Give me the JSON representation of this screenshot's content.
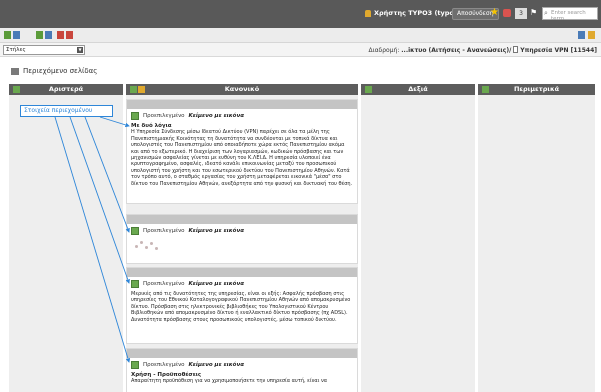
{
  "topbar": {
    "user_label": "Χρήστης TYPO3 (typo3user)",
    "logout_label": "Αποσύνδεση",
    "counter": "3",
    "search_placeholder": "Enter search term"
  },
  "selector": {
    "value": "Στήλες"
  },
  "breadcrumb": {
    "prefix": "Διαδρομή:",
    "path": "...iκτυο (Αιτήσεις - Ανανεώσεις)/",
    "page": "Υπηρεσία VPN [11544]"
  },
  "section_title": "Περιεχόμενο σελίδας",
  "columns": [
    {
      "label": "Αριστερά"
    },
    {
      "label": "Κανονικό"
    },
    {
      "label": "Δεξιά"
    },
    {
      "label": "Περιμετρικά"
    }
  ],
  "callout_label": "Στοιχεία περιεχομένου",
  "content_elements": [
    {
      "prefix": "Προεπιλεγμένο",
      "type": "Κείμενο με εικόνα",
      "heading": "Με δυό λόγια",
      "body": "Η Υπηρεσία Σύνδεσης μέσω Ιδεατού Δικτύου (VPN) παρέχει σε όλα τα μέλη της Πανεπιστημιακής Κοινότητας τη δυνατότητα να συνδέονται με τοπικά δίκτυα και υπολογιστές του Πανεπιστημίου από οποιαδήποτε χώρα εκτός Πανεπιστημίου ακόμα και από το εξωτερικό. Η διαχείριση των λογαριασμών, κωδικών πρόσβασης και των μηχανισμών ασφαλείας γίνεται με ευθύνη του Κ.ΛΕΙ.Δ. Η υπηρεσία υλοποιεί ένα κρυπτογραφημένο, ασφαλές, ιδεατό κανάλι επικοινωνίας μεταξύ του προσωπικού υπολογιστή του χρήστη και του εσωτερικού δικτύου του Πανεπιστημίου Αθηνών. Κατά τον τρόπο αυτό, ο σταθμός εργασίας του χρήστη μεταφέρεται εικονικά \"μέσα\" στο δίκτυο του Πανεπιστημίου Αθηνών, ανεξάρτητα από την φυσική και δικτυακή του θέση."
    },
    {
      "prefix": "Προεπιλεγμένο",
      "type": "Κείμενο με εικόνα"
    },
    {
      "prefix": "Προεπιλεγμένο",
      "type": "Κείμενο με εικόνα",
      "body": "Μερικές από τις δυνατότητες της υπηρεσίας, είναι οι εξής: Ασφαλής πρόσβαση στις υπηρεσίες του Εθνικού Καταλογογραφικού Πανεπιστημίου Αθηνών από απομακρυσμένο δίκτυο. Πρόσβαση στις ηλεκτρονικές βιβλιοθήκες του Υπολογιστικού Κέντρου Βιβλιοθηκών από απομακρυσμένο δίκτυο ή εναλλακτικό δίκτυο πρόσβασης (πχ ADSL). Δυνατότητα πρόσβασης στους προσωπικούς υπολογιστές, μέσω τοπικού δικτύου."
    },
    {
      "prefix": "Προεπιλεγμένο",
      "type": "Κείμενο με εικόνα",
      "heading": "Χρήση - Προϋποθέσεις",
      "body": "Απαραίτητη προϋπόθεση για να χρησιμοποιήσετε την υπηρεσία αυτή, είναι να"
    }
  ],
  "colors": {
    "topbar": "#595959",
    "column_header": "#5d5d5d",
    "callout": "#2e86d8",
    "content_icon": "#6aa84f"
  },
  "icons": [
    "user-icon",
    "star-icon",
    "shortcut-icon",
    "search-icon",
    "page-icon",
    "content-element-icon",
    "edit-icon"
  ]
}
